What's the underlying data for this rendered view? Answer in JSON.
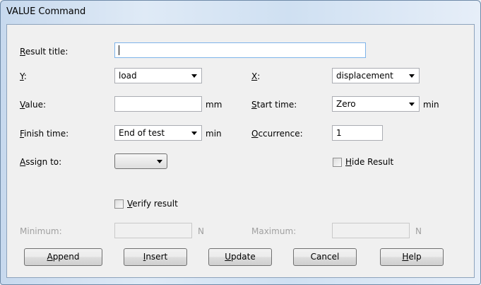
{
  "window": {
    "title": "VALUE Command"
  },
  "form": {
    "result_title": {
      "label_key": "R",
      "label_rest": "esult title:",
      "value": ""
    },
    "y": {
      "label_key": "Y",
      "label_rest": ":",
      "value": "load"
    },
    "x": {
      "label_key": "X",
      "label_rest": ":",
      "value": "displacement"
    },
    "value": {
      "label_key": "V",
      "label_rest": "alue:",
      "value": "",
      "unit": "mm"
    },
    "start_time": {
      "label_key": "S",
      "label_rest": "tart time:",
      "value": "Zero",
      "unit": "min"
    },
    "finish_time": {
      "label_key": "F",
      "label_rest": "inish time:",
      "value": "End of test",
      "unit": "min"
    },
    "occurrence": {
      "label_key": "O",
      "label_rest": "ccurrence:",
      "value": "1"
    },
    "assign_to": {
      "label_key": "A",
      "label_rest": "ssign to:",
      "value": ""
    },
    "hide_result": {
      "label_key": "H",
      "label_rest": "ide Result",
      "checked": false
    },
    "verify_result": {
      "label_key": "V",
      "label_rest": "erify result",
      "checked": false
    },
    "minimum": {
      "label": "Minimum:",
      "value": "",
      "unit": "N"
    },
    "maximum": {
      "label": "Maximum:",
      "value": "",
      "unit": "N"
    }
  },
  "buttons": {
    "append": {
      "key": "A",
      "rest": "ppend"
    },
    "insert": {
      "key": "I",
      "rest": "nsert"
    },
    "update": {
      "key": "U",
      "rest": "pdate"
    },
    "cancel": {
      "label": "Cancel"
    },
    "help": {
      "key": "H",
      "rest": "elp"
    }
  },
  "colors": {
    "title_gradient": "#c7d9ee",
    "client_bg": "#f0f0f0",
    "disabled_text": "#a0a0a0",
    "focus_border": "#7eb4ea"
  }
}
